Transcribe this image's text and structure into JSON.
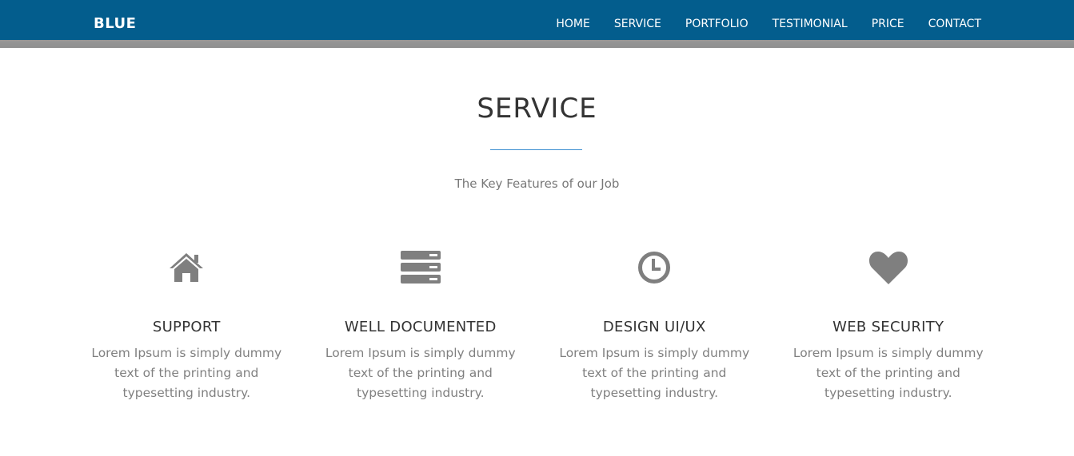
{
  "header": {
    "brand": "BLUE",
    "nav": [
      {
        "label": "HOME"
      },
      {
        "label": "SERVICE"
      },
      {
        "label": "PORTFOLIO"
      },
      {
        "label": "TESTIMONIAL"
      },
      {
        "label": "PRICE"
      },
      {
        "label": "CONTACT"
      }
    ],
    "colors": {
      "navbar": "#035d8d",
      "accent_line": "#3d8fd1"
    }
  },
  "service": {
    "title": "SERVICE",
    "subtitle": "The Key Features of our Job",
    "features": [
      {
        "icon": "home-icon",
        "title": "SUPPORT",
        "text": "Lorem Ipsum is simply dummy text of the printing and typesetting industry."
      },
      {
        "icon": "server-icon",
        "title": "WELL DOCUMENTED",
        "text": "Lorem Ipsum is simply dummy text of the printing and typesetting industry."
      },
      {
        "icon": "clock-icon",
        "title": "DESIGN UI/UX",
        "text": "Lorem Ipsum is simply dummy text of the printing and typesetting industry."
      },
      {
        "icon": "heart-icon",
        "title": "WEB SECURITY",
        "text": "Lorem Ipsum is simply dummy text of the printing and typesetting industry."
      }
    ]
  }
}
